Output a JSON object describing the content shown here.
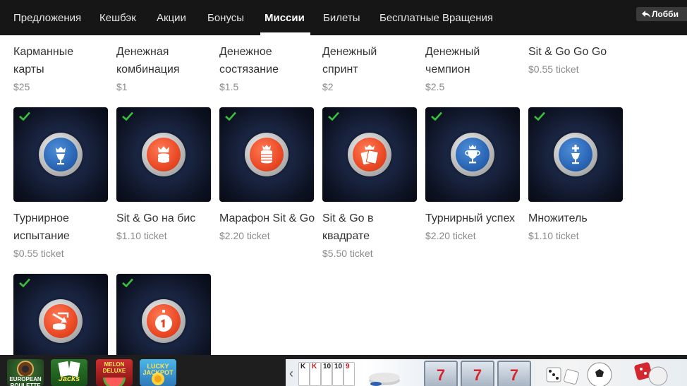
{
  "nav": {
    "tabs": [
      {
        "label": "Предложения"
      },
      {
        "label": "Кешбэк"
      },
      {
        "label": "Акции"
      },
      {
        "label": "Бонусы"
      },
      {
        "label": "Миссии",
        "active": true
      },
      {
        "label": "Билеты"
      },
      {
        "label": "Бесплатные Вращения"
      }
    ],
    "lobby_label": "Лобби"
  },
  "missions_top": [
    {
      "title": "Карманные карты",
      "price": "$25"
    },
    {
      "title": "Денежная комбинация",
      "price": "$1"
    },
    {
      "title": "Денежное состязание",
      "price": "$1.5"
    },
    {
      "title": "Денежный спринт",
      "price": "$2"
    },
    {
      "title": "Денежный чемпион",
      "price": "$2.5"
    },
    {
      "title": "Sit & Go Go Go",
      "price": "$0.55 ticket"
    }
  ],
  "missions_mid": [
    {
      "title": "Турнирное испытание",
      "price": "$0.55 ticket",
      "icon": "crown-cup-icon",
      "color": "blue",
      "completed": true
    },
    {
      "title": "Sit & Go на бис",
      "price": "$1.10 ticket",
      "icon": "crown-chips-icon",
      "color": "red",
      "completed": true
    },
    {
      "title": "Марафон Sit & Go",
      "price": "$2.20 ticket",
      "icon": "crown-chip-stack-icon",
      "color": "red",
      "completed": true
    },
    {
      "title": "Sit & Go в квадрате",
      "price": "$5.50 ticket",
      "icon": "crown-cards-icon",
      "color": "red",
      "completed": true
    },
    {
      "title": "Турнирный успех",
      "price": "$2.20 ticket",
      "icon": "crown-trophy-icon",
      "color": "blue",
      "completed": true
    },
    {
      "title": "Множитель",
      "price": "$1.10 ticket",
      "icon": "plus-cup-icon",
      "color": "blue",
      "completed": true
    }
  ],
  "missions_bottom": [
    {
      "icon": "chips-arrow-icon",
      "color": "red",
      "completed": true
    },
    {
      "icon": "stopwatch-one-icon",
      "color": "red",
      "completed": true
    }
  ],
  "games": [
    {
      "name": "EUROPEAN ROULETTE",
      "icon": "roulette-icon"
    },
    {
      "name": "Jacks",
      "icon": "cards-icon"
    },
    {
      "name": "MELON DELUXE",
      "icon": "melon-icon"
    },
    {
      "name": "LUCKY JACKPOT",
      "icon": "jackpot-icon"
    }
  ],
  "banner": {
    "card_ranks": [
      "K",
      "K",
      "10",
      "10",
      "9"
    ],
    "slot_symbols": [
      "7",
      "7",
      "7"
    ]
  },
  "colors": {
    "nav_bg": "#161616",
    "check": "#36c23a",
    "badge_blue": "#2a66b5",
    "badge_red": "#ea4a25"
  }
}
